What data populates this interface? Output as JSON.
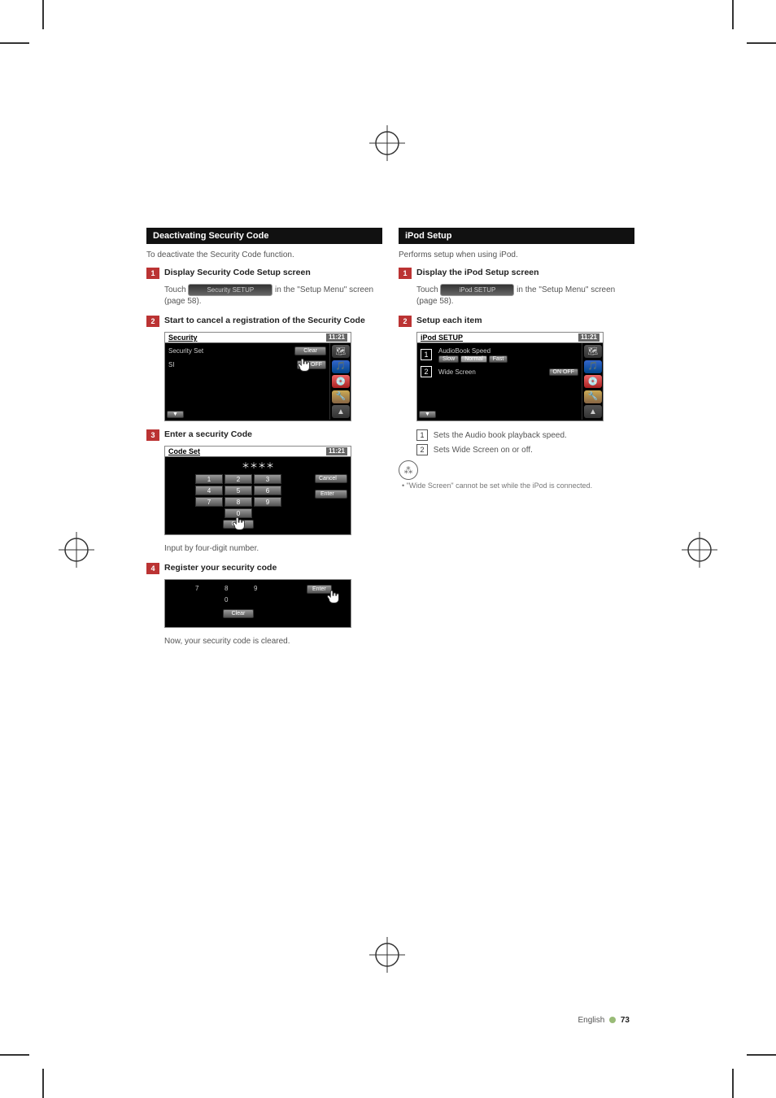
{
  "page_footer": {
    "language": "English",
    "number": "73"
  },
  "left": {
    "section_title": "Deactivating Security Code",
    "intro": "To deactivate the Security Code function.",
    "steps": [
      {
        "num": "1",
        "title": "Display Security Code Setup screen",
        "body_pre": "Touch ",
        "chip": "Security SETUP",
        "body_post": " in the \"Setup Menu\" screen (page 58)."
      },
      {
        "num": "2",
        "title": "Start to cancel a registration of the Security Code",
        "screenshot": {
          "title": "Security",
          "time": "11:21",
          "row1": "Security Set",
          "row2": "SI",
          "btn1": "Clear",
          "btn2": "ON   OFF"
        }
      },
      {
        "num": "3",
        "title": "Enter a security Code",
        "screenshot": {
          "title": "Code Set",
          "time": "11:21",
          "stars": "＊＊＊＊",
          "keys": [
            "1",
            "2",
            "3",
            "4",
            "5",
            "6",
            "7",
            "8",
            "9",
            "",
            "0",
            ""
          ],
          "cancel": "Cancel",
          "enter": "Enter",
          "clear": "Clear"
        },
        "after": "Input by four-digit number."
      },
      {
        "num": "4",
        "title": "Register your security code",
        "screenshot": {
          "row_keys": [
            "7",
            "8",
            "9"
          ],
          "zero": "0",
          "enter": "Enter",
          "clear": "Clear"
        },
        "after": "Now, your security code is cleared."
      }
    ]
  },
  "right": {
    "section_title": "iPod Setup",
    "intro": "Performs setup when using iPod.",
    "steps": [
      {
        "num": "1",
        "title": "Display the iPod Setup screen",
        "body_pre": "Touch ",
        "chip": "iPod SETUP",
        "body_post": " in the \"Setup Menu\" screen (page 58)."
      },
      {
        "num": "2",
        "title": "Setup each item",
        "screenshot": {
          "title": "iPod SETUP",
          "time": "11:21",
          "row1_label": "AudioBook Speed",
          "row1_opts": [
            "Slow",
            "Normal",
            "Fast"
          ],
          "row2_label": "Wide Screen",
          "row2_opts": "ON    OFF"
        },
        "callouts": [
          {
            "n": "1",
            "text": "Sets the Audio book playback speed."
          },
          {
            "n": "2",
            "text": "Sets Wide Screen on or off."
          }
        ],
        "note": "•  \"Wide Screen\" cannot be set while the iPod is connected."
      }
    ]
  }
}
